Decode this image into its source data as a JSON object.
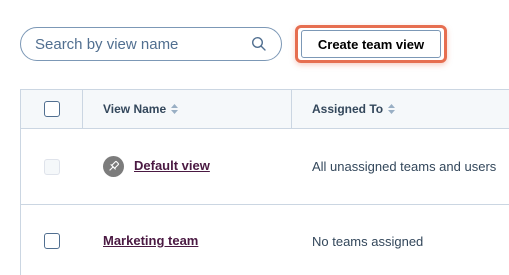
{
  "search": {
    "placeholder": "Search by view name"
  },
  "toolbar": {
    "create_label": "Create team view",
    "highlight_color": "#e66e50"
  },
  "table": {
    "headers": {
      "view_name": "View Name",
      "assigned_to": "Assigned To"
    },
    "rows": [
      {
        "name": "Default view",
        "assigned": "All unassigned teams and users",
        "pinned": true,
        "checkbox_disabled": true
      },
      {
        "name": "Marketing team",
        "assigned": "No teams assigned",
        "pinned": false,
        "checkbox_disabled": false
      }
    ]
  },
  "icons": {
    "search": "search-icon",
    "sort": "sort-icon",
    "pin": "pin-icon"
  }
}
